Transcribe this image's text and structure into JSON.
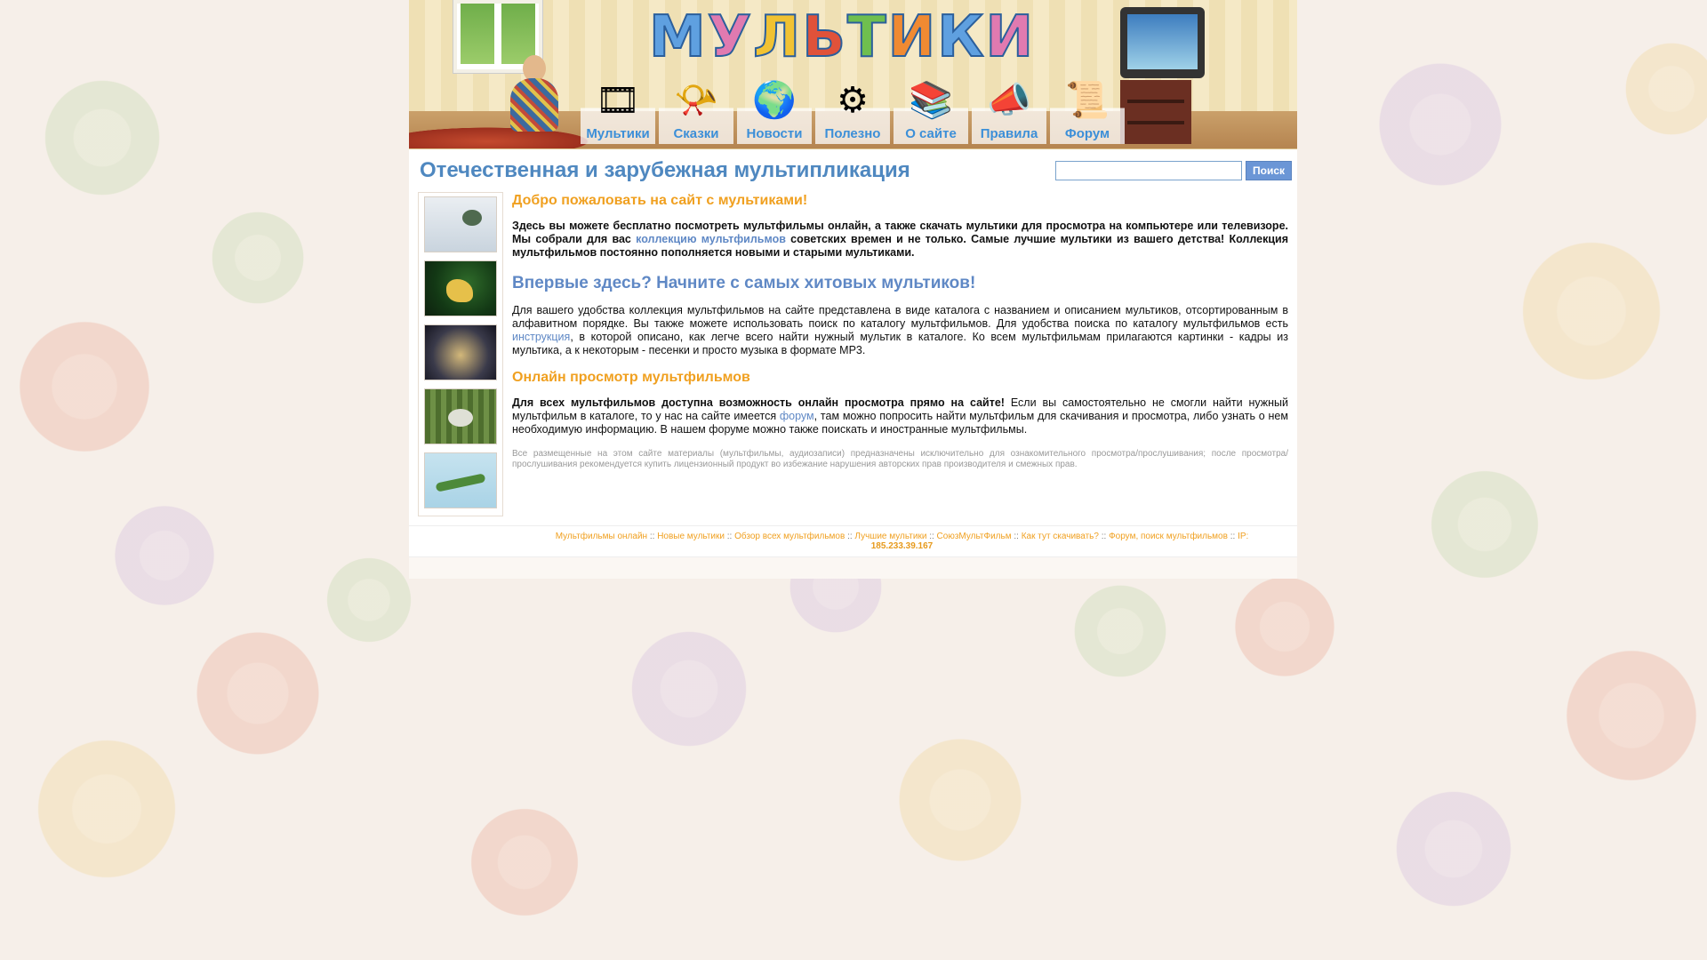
{
  "header": {
    "logo_text": [
      "М",
      "У",
      "Л",
      "Ь",
      "Т",
      "И",
      "К",
      "И"
    ],
    "logo_colors": [
      "#5fa0e0",
      "#e07ab0",
      "#f1c232",
      "#e0523a",
      "#6fbf4f",
      "#f08a32",
      "#5fa0e0",
      "#e07ab0"
    ],
    "nav": [
      {
        "label": "Мультики",
        "icon": "film-reel-icon",
        "glyph": "🎞"
      },
      {
        "label": "Сказки",
        "icon": "gramophone-icon",
        "glyph": "📯"
      },
      {
        "label": "Новости",
        "icon": "globe-icon",
        "glyph": "🌍"
      },
      {
        "label": "Полезно",
        "icon": "gear-icon",
        "glyph": "⚙"
      },
      {
        "label": "О сайте",
        "icon": "books-icon",
        "glyph": "📚"
      },
      {
        "label": "Правила",
        "icon": "megaphone-icon",
        "glyph": "📣"
      },
      {
        "label": "Форум",
        "icon": "scroll-icon",
        "glyph": "📜"
      }
    ]
  },
  "title": "Отечественная и зарубежная мультипликация",
  "search": {
    "button": "Поиск",
    "value": ""
  },
  "welcome": {
    "heading": "Добро пожаловать на сайт с мультиками!",
    "p1_start": "Здесь вы можете бесплатно посмотреть мультфильмы онлайн, а также скачать мультики для просмотра на компьютере или телевизоре. Мы собрали для вас ",
    "p1_link": "коллекцию мультфильмов",
    "p1_end": " советских времен и не только. Самые лучшие мультики из вашего детства! Коллекция мультфильмов постоянно пополняется новыми и старыми мультиками."
  },
  "first": {
    "heading": "Впервые здесь? Начните с самых хитовых мультиков!",
    "p_start": "Для вашего удобства коллекция мультфильмов на сайте представлена в виде каталога с названием и описанием мультиков, отсортированным в алфавитном порядке. Вы также можете использовать поиск по каталогу мультфильмов. Для удобства поиска по каталогу мультфильмов есть ",
    "p_link": "инструкция",
    "p_end": ", в которой описано, как легче всего найти нужный мультик в каталоге. Ко всем мультфильмам прилагаются картинки - кадры из мультика, а к некоторым - песенки и просто музыка в формате MP3."
  },
  "online": {
    "heading": "Онлайн просмотр мультфильмов",
    "p_bold": "Для всех мультфильмов доступна возможность онлайн просмотра прямо на сайте!",
    "p_mid": " Если вы самостоятельно не смогли найти нужный мультфильм в каталоге, то у нас на сайте имеется ",
    "p_link": "форум",
    "p_end": ", там можно попросить найти мультфильм для скачивания и просмотра, либо узнать о нем необходимую информацию. В нашем форуме можно также поискать и иностранные мультфильмы."
  },
  "disclaimer": "Все размещенные на этом сайте материалы (мультфильмы, аудиозаписи) предназначены исключительно для ознакомительного просмотра/прослушивания; после просмотра/прослушивания рекомендуется купить лицензионный продукт во избежание нарушения авторских прав производителя и смежных прав.",
  "footer": {
    "links": [
      "Мультфильмы онлайн",
      "Новые мультики",
      "Обзор всех мультфильмов",
      "Лучшие мультики",
      "СоюзМультФильм",
      "Как тут скачивать?",
      "Форум, поиск мультфильмов"
    ],
    "separator": " :: ",
    "ip_label": "IP:",
    "ip": "185.233.39.167"
  }
}
